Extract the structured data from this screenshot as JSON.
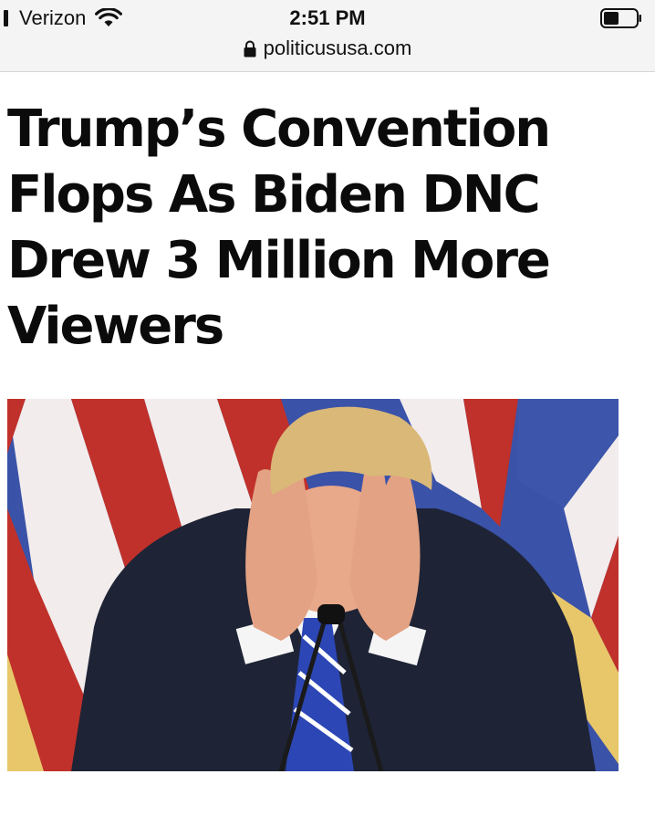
{
  "status_bar": {
    "carrier": "Verizon",
    "time": "2:51 PM",
    "icons": [
      "signal-icon",
      "wifi-icon",
      "battery-icon"
    ]
  },
  "address_bar": {
    "url": "politicususa.com",
    "icon": "lock-icon"
  },
  "article": {
    "headline": "Trump’s Convention Flops As Biden DNC Drew 3 Million More Viewers",
    "image": "photo-man-holding-head-at-podium"
  },
  "colors": {
    "bar_bg": "#f4f4f4",
    "text": "#0b0b0b",
    "flag_red": "#c0312b",
    "flag_blue": "#3a52a8",
    "suit": "#1e2436",
    "hair": "#d9b878",
    "skin": "#e8a88a"
  }
}
